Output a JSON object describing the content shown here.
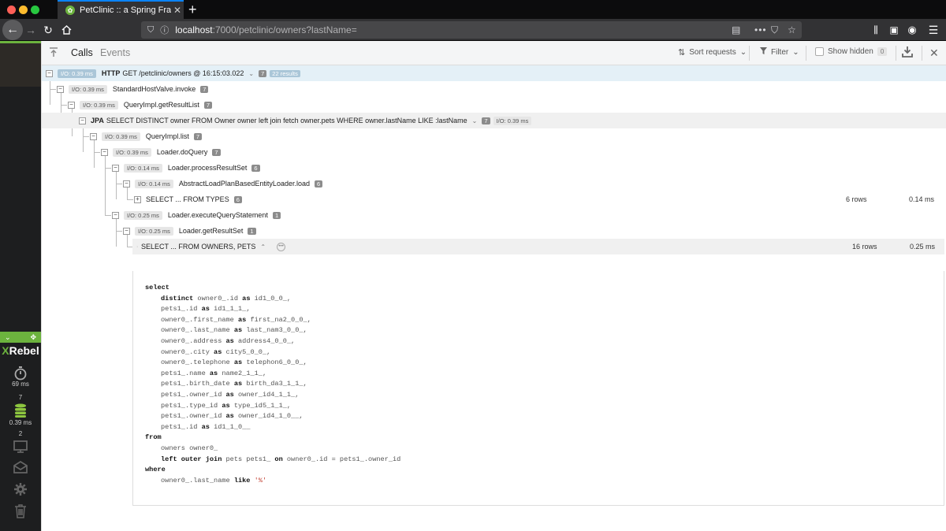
{
  "browser": {
    "tab_title": "PetClinic :: a Spring Framework demonstration",
    "url_host": "localhost",
    "url_path": ":7000/petclinic/owners?lastName="
  },
  "sidebar": {
    "logo_x": "X",
    "logo_rest": "Rebel",
    "timer_value": "69 ms",
    "db_count": "7",
    "db_time": "0.39 ms",
    "monitor_count": "2"
  },
  "toolbar": {
    "tabs": [
      "Calls",
      "Events"
    ],
    "sort_label": "Sort requests",
    "filter_label": "Filter",
    "show_hidden_label": "Show hidden",
    "hidden_count": "0"
  },
  "tree": [
    {
      "io": "I/O: 0.39 ms",
      "kind": "HTTP",
      "label": "GET /petclinic/owners @ 16:15:03.022",
      "badge": "7",
      "extra": "22 results"
    },
    {
      "io": "I/O: 0.39 ms",
      "label": "StandardHostValve.invoke",
      "badge": "7"
    },
    {
      "io": "I/O: 0.39 ms",
      "label": "QueryImpl.getResultList",
      "badge": "7"
    },
    {
      "kind": "JPA",
      "label": "SELECT DISTINCT owner FROM Owner owner left join fetch owner.pets WHERE owner.lastName LIKE :lastName",
      "badge": "7",
      "io": "I/O: 0.39 ms"
    },
    {
      "io": "I/O: 0.39 ms",
      "label": "QueryImpl.list",
      "badge": "7"
    },
    {
      "io": "I/O: 0.39 ms",
      "label": "Loader.doQuery",
      "badge": "7"
    },
    {
      "io": "I/O: 0.14 ms",
      "label": "Loader.processResultSet",
      "badge": "6"
    },
    {
      "io": "I/O: 0.14 ms",
      "label": "AbstractLoadPlanBasedEntityLoader.load",
      "badge": "6"
    },
    {
      "label": "SELECT ... FROM TYPES",
      "badge": "6",
      "rows": "6 rows",
      "time": "0.14 ms"
    },
    {
      "io": "I/O: 0.25 ms",
      "label": "Loader.executeQueryStatement",
      "badge": "1"
    },
    {
      "io": "I/O: 0.25 ms",
      "label": "Loader.getResultSet",
      "badge": "1"
    },
    {
      "label": "SELECT ... FROM OWNERS, PETS",
      "rows": "16 rows",
      "time": "0.25 ms"
    }
  ],
  "sql_lines": [
    {
      "kw": "select",
      "rest": ""
    },
    {
      "pre": "distinct ",
      "text": "owner0_.id ",
      "kw": "as",
      "rest": " id1_0_0_,"
    },
    {
      "text": "pets1_.id ",
      "kw": "as",
      "rest": " id1_1_1_,"
    },
    {
      "text": "owner0_.first_name ",
      "kw": "as",
      "rest": " first_na2_0_0_,"
    },
    {
      "text": "owner0_.last_name ",
      "kw": "as",
      "rest": " last_nam3_0_0_,"
    },
    {
      "text": "owner0_.address ",
      "kw": "as",
      "rest": " address4_0_0_,"
    },
    {
      "text": "owner0_.city ",
      "kw": "as",
      "rest": " city5_0_0_,"
    },
    {
      "text": "owner0_.telephone ",
      "kw": "as",
      "rest": " telephon6_0_0_,"
    },
    {
      "text": "pets1_.name ",
      "kw": "as",
      "rest": " name2_1_1_,"
    },
    {
      "text": "pets1_.birth_date ",
      "kw": "as",
      "rest": " birth_da3_1_1_,"
    },
    {
      "text": "pets1_.owner_id ",
      "kw": "as",
      "rest": " owner_id4_1_1_,"
    },
    {
      "text": "pets1_.type_id ",
      "kw": "as",
      "rest": " type_id5_1_1_,"
    },
    {
      "text": "pets1_.owner_id ",
      "kw": "as",
      "rest": " owner_id4_1_0__,"
    },
    {
      "text": "pets1_.id ",
      "kw": "as",
      "rest": " id1_1_0__"
    },
    {
      "kw": "from",
      "rest": ""
    },
    {
      "text": "owners owner0_",
      "rest": ""
    },
    {
      "pre": "left outer join ",
      "text": "pets pets1_ ",
      "kw": "on",
      "rest": " owner0_.id = pets1_.owner_id"
    },
    {
      "kw": "where",
      "rest": ""
    },
    {
      "text": "owner0_.last_name ",
      "kw": "like",
      "lit": "'%'",
      "rest": ""
    }
  ]
}
